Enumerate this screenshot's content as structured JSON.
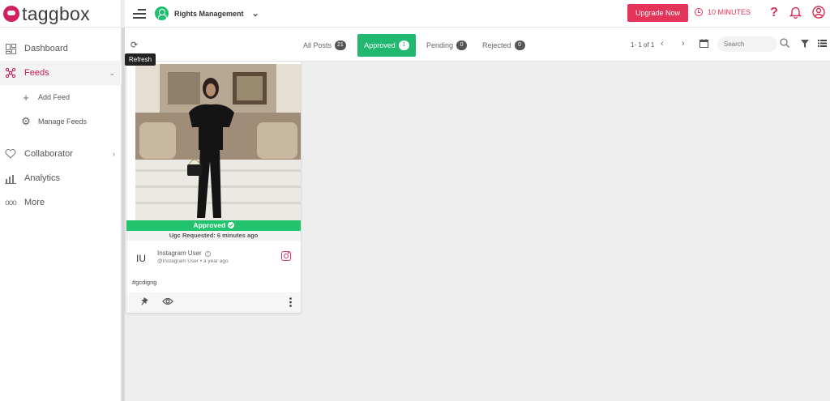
{
  "app": {
    "logo_text": "taggbox"
  },
  "sidebar": {
    "items": [
      {
        "label": "Dashboard",
        "icon": "dashboard-icon"
      },
      {
        "label": "Feeds",
        "icon": "feeds-icon",
        "active": true
      },
      {
        "label": "Collaborator",
        "icon": "collaborator-icon"
      },
      {
        "label": "Analytics",
        "icon": "analytics-icon"
      },
      {
        "label": "More",
        "icon": "more-icon"
      }
    ],
    "sub_items": [
      {
        "label": "Add Feed",
        "icon": "plus-icon"
      },
      {
        "label": "Manage Feeds",
        "icon": "gear-icon"
      }
    ]
  },
  "header": {
    "app_switch_label": "Rights Management",
    "upgrade_label": "Upgrade Now",
    "timer_label": "10 MINUTES",
    "help_glyph": "?",
    "accent_color": "#e5345a"
  },
  "toolbar": {
    "refresh_tooltip": "Refresh",
    "tabs": [
      {
        "label": "All Posts",
        "count": "21"
      },
      {
        "label": "Approved",
        "count": "1",
        "active": true
      },
      {
        "label": "Pending",
        "count": "0"
      },
      {
        "label": "Rejected",
        "count": "0"
      }
    ],
    "pager": "1- 1 of 1",
    "search_placeholder": "Search",
    "active_color": "#1fb86e"
  },
  "card": {
    "status": "Approved",
    "ugc_requested": "Ugc Requested: 6 minutes ago",
    "avatar_initials": "IU",
    "user_name": "Instagram User",
    "handle": "@Instagram User",
    "time": "a year ago",
    "hashtag": "#gcdigng",
    "status_color": "#21c46c"
  }
}
